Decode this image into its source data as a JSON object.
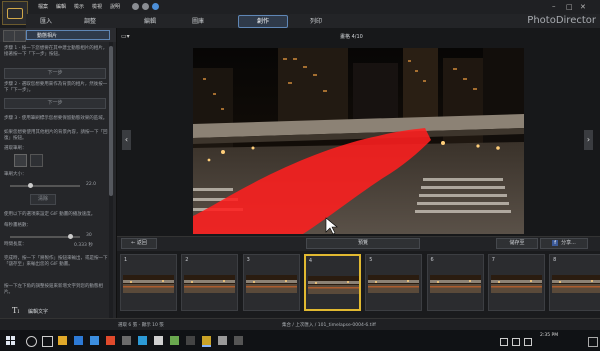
{
  "menu": {
    "items": [
      "檔案",
      "編輯",
      "檢示",
      "檢視",
      "說明"
    ]
  },
  "modes": {
    "tabs": [
      "匯入",
      "調整",
      "編輯",
      "圖庫",
      "創作",
      "列印"
    ],
    "active": "創作"
  },
  "brand": "PhotoDirector",
  "left_panel": {
    "tab_label": "動態相片",
    "step1": "步驟 1 - 按一下您想要在其中建立動態相片的相片，接著按一下「下一步」按鈕。",
    "next_label": "下一步",
    "step2": "步驟 2 - 選取您想要用來作為背景的相片，然後按一下「下一步」。",
    "next2_label": "下一步",
    "step3": "步驟 3 - 使用筆刷標示您想要保留動態效果的區域。",
    "step3b": "如果您想要使用其他相片的背景內容，請按一下「回復」按鈕。",
    "brush_label": "選取筆刷：",
    "brush_size_label": "筆刷大小：",
    "brush_size_value": "22.0",
    "reset_label": "清除",
    "step4": "使用以下的選項來設定 GIF 動畫的播放速度。",
    "speed_label": "每秒畫格數：",
    "speed_value": "30",
    "duration_label": "時間長度：",
    "duration_value": "0.333 秒",
    "finish_text": "完成時，按一下「將製作」按鈕來輸出，或是按一下「儲存至」來輸出您的 GIF 動畫。",
    "finish_text2": "按一下左下角的調整按鈕來新增文字到您的動態相片。",
    "edit_text_label": "編輯文字"
  },
  "preview": {
    "counter": "畫格 4/10"
  },
  "film_toolbar": {
    "back_label": "返回",
    "preview_label": "預覽",
    "save_label": "儲存至",
    "share_label": "分享..."
  },
  "frames": [
    "1",
    "2",
    "3",
    "4",
    "5",
    "6",
    "7",
    "8"
  ],
  "selected_frame": "4",
  "status": {
    "left": "選取 6 張 - 顯示 10 張",
    "center": "集合 / 上次匯入 / 101_timelapse-0004-6.tiff"
  },
  "taskbar": {
    "time": "2:35 PM"
  },
  "colors": {
    "accent": "#5f86b5",
    "selected_frame": "#e1b931",
    "mask_overlay": "#ff1f1f"
  }
}
